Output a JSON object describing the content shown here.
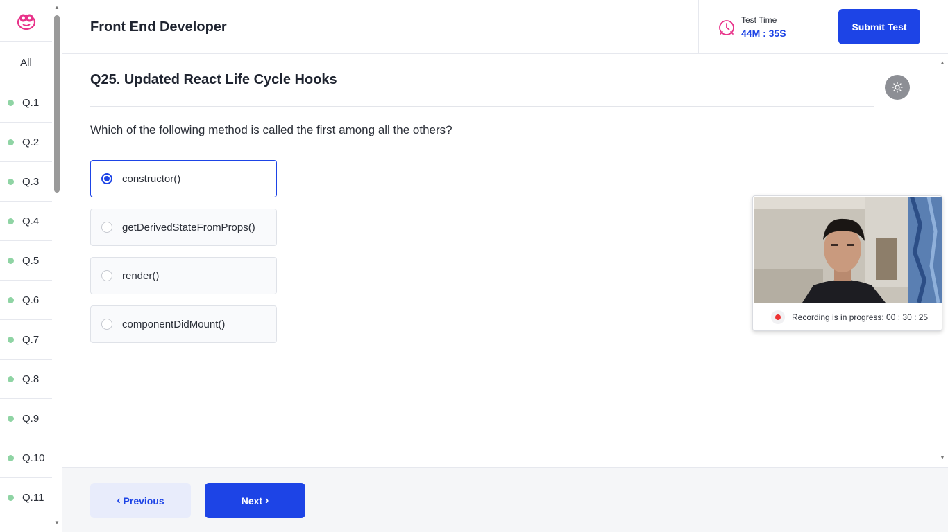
{
  "header": {
    "title": "Front End Developer",
    "timer_label": "Test Time",
    "timer_value": "44M : 35S",
    "submit_label": "Submit Test"
  },
  "sidebar": {
    "all_label": "All",
    "items": [
      "Q.1",
      "Q.2",
      "Q.3",
      "Q.4",
      "Q.5",
      "Q.6",
      "Q.7",
      "Q.8",
      "Q.9",
      "Q.10",
      "Q.11"
    ]
  },
  "question": {
    "title": "Q25. Updated React Life Cycle Hooks",
    "text": "Which of the following method is called the first among all the others?",
    "options": [
      "constructor()",
      "getDerivedStateFromProps()",
      "render()",
      "componentDidMount()"
    ],
    "selected_index": 0
  },
  "camera": {
    "recording_text": "Recording is in progress: 00 : 30 : 25"
  },
  "footer": {
    "previous_label": "Previous",
    "next_label": "Next"
  },
  "colors": {
    "accent": "#1d44e6",
    "status_answered": "#8fd4a4",
    "timer_icon": "#e8338a",
    "recording": "#e33333"
  },
  "icons": {
    "logo": "mascot-face-icon",
    "timer": "clock-icon",
    "theme": "sun-icon"
  }
}
